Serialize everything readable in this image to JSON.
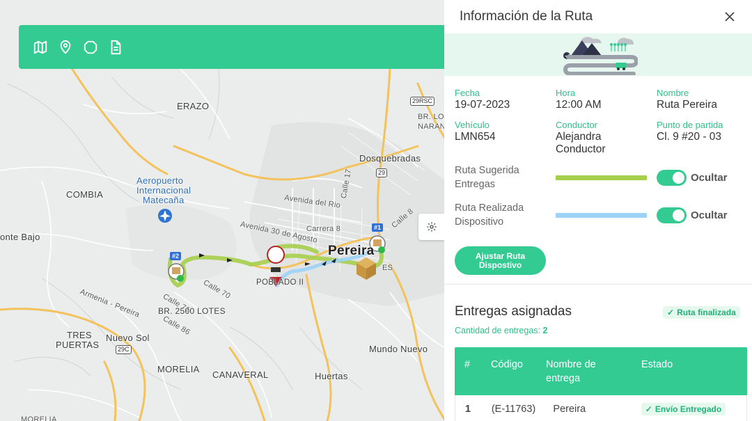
{
  "map": {
    "labels": {
      "erazo": "ERAZO",
      "br_lo": "BR. LO",
      "naran": "NARAN",
      "dosquebradas": "Dosquebradas",
      "aeropuerto": "Aeropuerto",
      "internacional": "Internacional",
      "matecana": "Matecaña",
      "combia": "COMBIA",
      "monte_bajo": "onte Bajo",
      "avenida_del_rio": "Avenida del Rio",
      "avenida_30": "Avenida 30 de Agosto",
      "carrera_8": "Carrera 8",
      "calle_17": "Calle 17",
      "calle_8": "Calle 8",
      "pereira": "Pereira",
      "es": "ES",
      "poblado": "POBLADO II",
      "calle_70": "Calle 70",
      "calle_71": "Calle 71",
      "calle_86": "Calle 86",
      "br_2500": "BR. 2500 LOTES",
      "armenia_pereira": "Armenia - Pereira",
      "tres": "TRES",
      "puertas": "PUERTAS",
      "nuevo_sol": "Nuevo Sol",
      "mundo_nuevo": "Mundo Nuevo",
      "morelia": "MORELIA",
      "canaveral": "CANAVERAL",
      "huertas": "Huertas",
      "morelia_bottom": "MORELIA",
      "shield_29rsc": "29RSC",
      "shield_29": "29",
      "shield_29c": "29C"
    },
    "markers": {
      "stop1": "#1",
      "stop2": "#2"
    }
  },
  "panel": {
    "title": "Información de la Ruta",
    "fields": [
      {
        "label": "Fecha",
        "value": "19-07-2023"
      },
      {
        "label": "Hora",
        "value": "12:00 AM"
      },
      {
        "label": "Nombre",
        "value": "Ruta Pereira"
      },
      {
        "label": "Vehículo",
        "value": "LMN654"
      },
      {
        "label": "Conductor",
        "value": "Alejandra Conductor"
      },
      {
        "label": "Punto de partida",
        "value": "Cl. 9 #20 - 03"
      }
    ],
    "routes": [
      {
        "label": "Ruta Sugerida Entregas",
        "color": "#a6cf4c",
        "toggle": "Ocultar"
      },
      {
        "label": "Ruta Realizada Dispositivo",
        "color": "#9dd3f7",
        "toggle": "Ocultar"
      }
    ],
    "adjust_button": "Ajustar Ruta Dispostivo",
    "deliveries": {
      "title": "Entregas asignadas",
      "status": "Ruta finalizada",
      "count_label": "Cantidad de entregas:",
      "count_value": "2",
      "headers": [
        "#",
        "Código",
        "Nombre de entrega",
        "Estado"
      ],
      "rows": [
        {
          "num": "1",
          "code": "(E-11763)",
          "name": "Pereira",
          "status": "Envío Entregado"
        }
      ]
    }
  },
  "colors": {
    "accent": "#34cb93",
    "suggested_route": "#a6cf4c",
    "device_route": "#9dd3f7"
  }
}
